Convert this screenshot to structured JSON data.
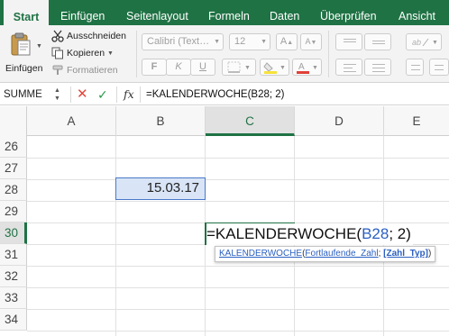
{
  "ribbon": {
    "tabs": [
      {
        "label": "Start",
        "active": true
      },
      {
        "label": "Einfügen",
        "active": false
      },
      {
        "label": "Seitenlayout",
        "active": false
      },
      {
        "label": "Formeln",
        "active": false
      },
      {
        "label": "Daten",
        "active": false
      },
      {
        "label": "Überprüfen",
        "active": false
      },
      {
        "label": "Ansicht",
        "active": false
      }
    ],
    "clipboard": {
      "paste_label": "Einfügen",
      "cut_label": "Ausschneiden",
      "copy_label": "Kopieren",
      "format_painter_label": "Formatieren"
    },
    "font": {
      "font_name": "Calibri (Text…",
      "font_size": "12",
      "grow_label": "A",
      "shrink_label": "A",
      "bold": "F",
      "italic": "K",
      "underline": "U"
    }
  },
  "formula_bar": {
    "name_box": "SUMME",
    "cancel": "✕",
    "enter": "✓",
    "fx": "fx",
    "formula": "=KALENDERWOCHE(B28; 2)"
  },
  "grid": {
    "columns": [
      {
        "label": "A",
        "selected": false
      },
      {
        "label": "B",
        "selected": false
      },
      {
        "label": "C",
        "selected": true
      },
      {
        "label": "D",
        "selected": false
      },
      {
        "label": "E",
        "selected": false
      }
    ],
    "rows": [
      {
        "label": "26",
        "selected": false
      },
      {
        "label": "27",
        "selected": false
      },
      {
        "label": "28",
        "selected": false
      },
      {
        "label": "29",
        "selected": false
      },
      {
        "label": "30",
        "selected": true
      },
      {
        "label": "31",
        "selected": false
      },
      {
        "label": "32",
        "selected": false
      },
      {
        "label": "33",
        "selected": false
      },
      {
        "label": "34",
        "selected": false
      }
    ],
    "b28_value": "15.03.17",
    "editing": {
      "prefix": "=KALENDERWOCHE(",
      "ref": "B28",
      "suffix": "; 2)"
    },
    "tooltip": {
      "function_name": "KALENDERWOCHE",
      "open_paren": "(",
      "arg1": "Fortlaufende_Zahl",
      "separator": "; ",
      "arg2": "[Zahl_Typ]",
      "close_paren": ")"
    }
  },
  "colors": {
    "accent": "#1f7244",
    "reference": "#2a5fc1",
    "cancel": "#e2473b",
    "enter": "#2a9a48"
  }
}
